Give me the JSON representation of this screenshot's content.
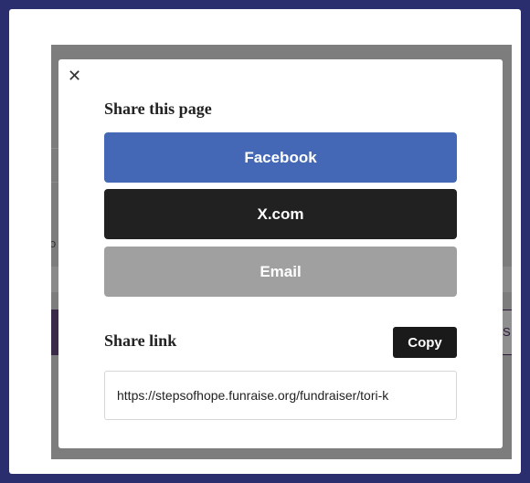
{
  "modal": {
    "close_icon": "close-icon",
    "close_glyph": "✕",
    "title": "Share this page",
    "share_buttons": [
      {
        "label": "Facebook",
        "color": "#4468b5"
      },
      {
        "label": "X.com",
        "color": "#212121"
      },
      {
        "label": "Email",
        "color": "#a0a0a0"
      }
    ],
    "share_link_label": "Share link",
    "copy_label": "Copy",
    "share_link_value": "https://stepsofhope.funraise.org/fundraiser/tori-k"
  },
  "background": {
    "right_button_fragment": "S",
    "left_text_fragment": "o"
  }
}
